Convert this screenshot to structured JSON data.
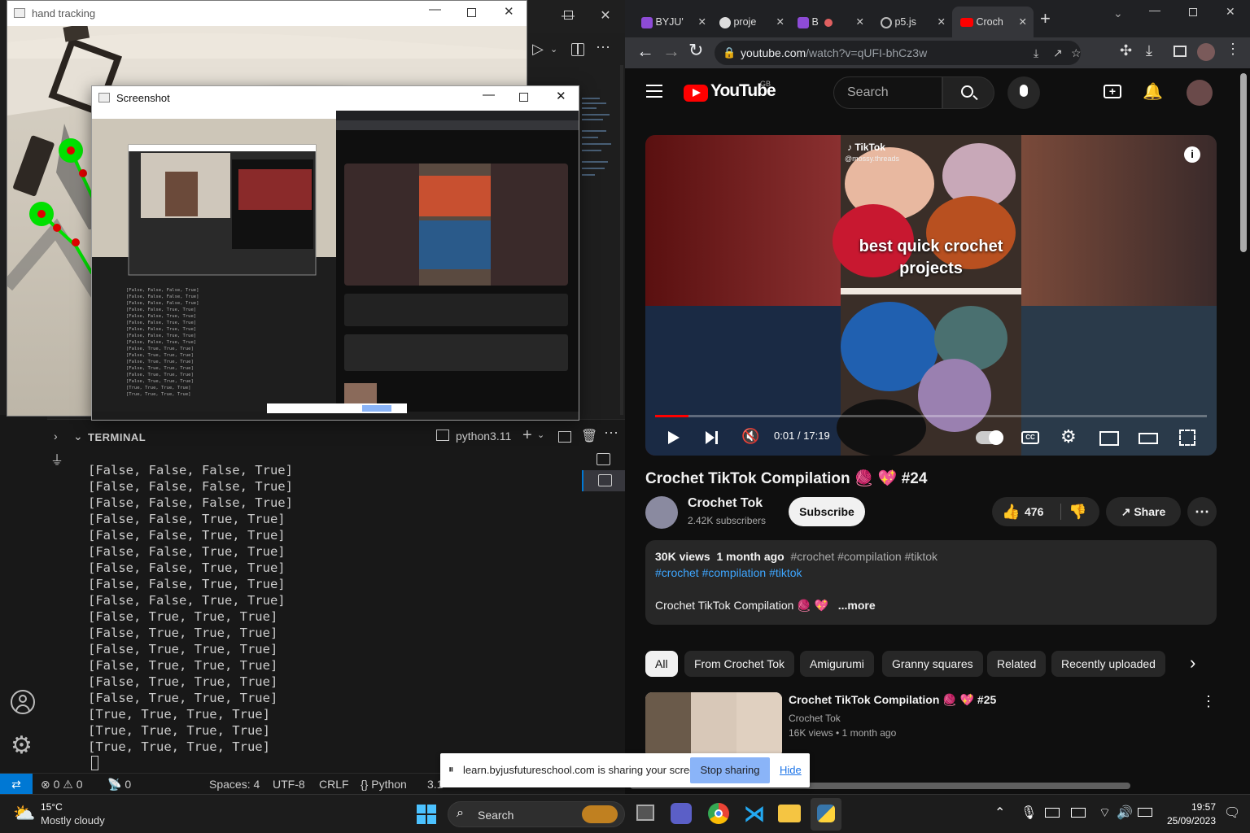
{
  "vscode": {
    "window_controls": [
      "—",
      "☐",
      "✕"
    ],
    "run_icon": "▷",
    "terminal": {
      "tab_label": "TERMINAL",
      "shell_label": "python3.11",
      "lines": [
        "[False, False, False, True]",
        "[False, False, False, True]",
        "[False, False, False, True]",
        "[False, False, True, True]",
        "[False, False, True, True]",
        "[False, False, True, True]",
        "[False, False, True, True]",
        "[False, False, True, True]",
        "[False, False, True, True]",
        "[False, True, True, True]",
        "[False, True, True, True]",
        "[False, True, True, True]",
        "[False, True, True, True]",
        "[False, True, True, True]",
        "[False, True, True, True]",
        "[True, True, True, True]",
        "[True, True, True, True]",
        "[True, True, True, True]"
      ]
    },
    "status": {
      "errors": "0",
      "warnings": "0",
      "ports": "0",
      "spaces": "Spaces: 4",
      "encoding": "UTF-8",
      "eol": "CRLF",
      "language": "Python",
      "version": "3.1"
    }
  },
  "hand_window": {
    "title": "hand tracking"
  },
  "screenshot_window": {
    "title": "Screenshot"
  },
  "chrome": {
    "tabs": [
      {
        "label": "BYJU'",
        "icon": "byjus-icon"
      },
      {
        "label": "proje",
        "icon": "github-icon"
      },
      {
        "label": "B",
        "icon": "byjus-icon"
      },
      {
        "label": "p5.js",
        "icon": "p5-icon"
      },
      {
        "label": "Croch",
        "icon": "youtube-icon"
      }
    ],
    "url_domain": "youtube.com",
    "url_path": "/watch?v=qUFI-bhCz3w"
  },
  "youtube": {
    "logo_text": "YouTube",
    "region": "GB",
    "search_placeholder": "Search",
    "video": {
      "tiktok_label": "TikTok",
      "tiktok_handle": "@mossy.threads",
      "overlay_text": "best quick crochet projects",
      "time": "0:01 / 17:19",
      "progress": 0.001
    },
    "title": "Crochet TikTok Compilation 🧶 💖 #24",
    "channel": "Crochet Tok",
    "subscribers": "2.42K subscribers",
    "subscribe_label": "Subscribe",
    "likes": "476",
    "share_label": "Share",
    "description": {
      "views": "30K views",
      "ago": "1 month ago",
      "tags_inline": "#crochet #compilation #tiktok",
      "tags_links": "#crochet #compilation #tiktok",
      "text": "Crochet TikTok Compilation 🧶 💖",
      "more": "...more"
    },
    "chips": [
      "All",
      "From Crochet Tok",
      "Amigurumi",
      "Granny squares",
      "Related",
      "Recently uploaded"
    ],
    "rec": {
      "title": "Crochet TikTok Compilation 🧶 💖 #25",
      "channel": "Crochet Tok",
      "meta": "16K views • 1 month ago"
    }
  },
  "sharebar": {
    "message": "learn.byjusfutureschool.com is sharing your screen.",
    "stop": "Stop sharing",
    "hide": "Hide"
  },
  "taskbar": {
    "temp": "15°C",
    "weather": "Mostly cloudy",
    "search": "Search",
    "time": "19:57",
    "date": "25/09/2023"
  }
}
